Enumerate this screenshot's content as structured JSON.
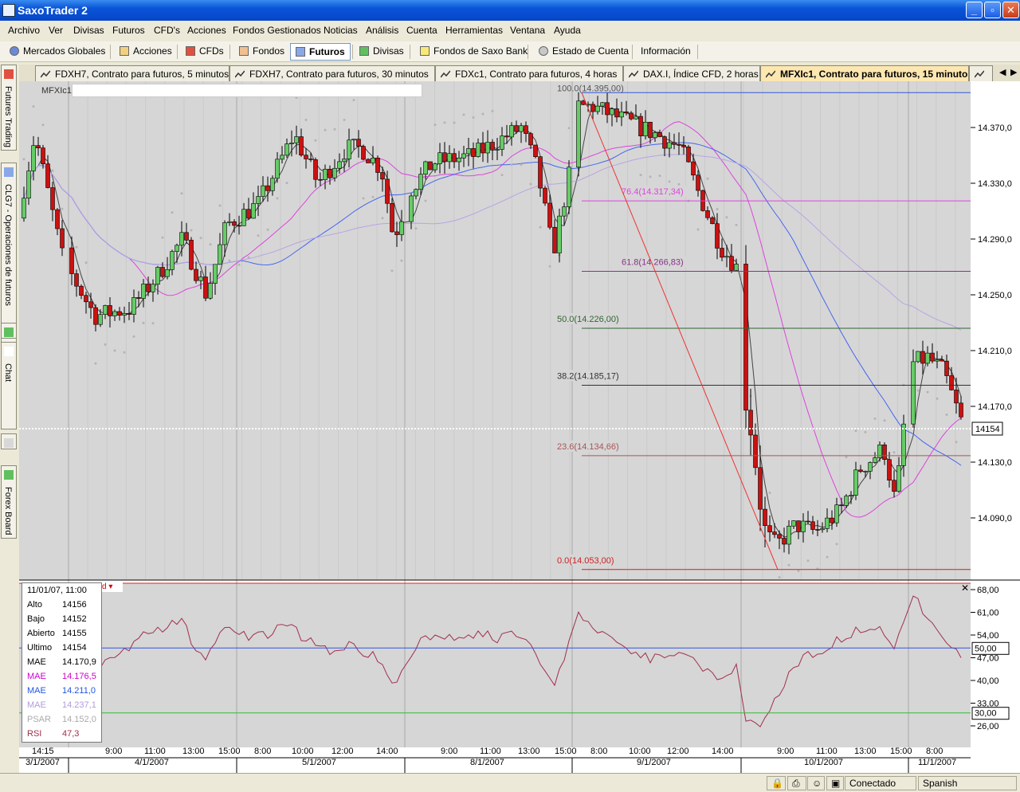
{
  "window": {
    "title": "SaxoTrader 2"
  },
  "menu": [
    "Archivo",
    "Ver",
    "Divisas",
    "Futuros",
    "CFD's",
    "Acciones",
    "Fondos Gestionados",
    "Noticias",
    "Análisis",
    "Cuenta",
    "Herramientas",
    "Ventana",
    "Ayuda"
  ],
  "toolbar": [
    "Mercados Globales",
    "Acciones",
    "CFDs",
    "Fondos",
    "Futuros",
    "Divisas",
    "Fondos de Saxo Bank",
    "Estado de Cuenta",
    "Información"
  ],
  "tabs": [
    "FDXH7, Contrato para futuros, 5 minutos",
    "FDXH7, Contrato para futuros, 30 minutos",
    "FDXc1, Contrato para futuros, 4 horas",
    "DAX.I, Índice CFD, 2 horas",
    "MFXIc1, Contrato para futuros, 15 minutos"
  ],
  "side_tabs": [
    "Futures Trading",
    "CLG7 - Operaciones de futuros",
    "Chat",
    "Forex Board"
  ],
  "chart": {
    "symbol_label": "MFXIc1",
    "price_axis": [
      "14.370,0",
      "14.330,0",
      "14.290,0",
      "14.250,0",
      "14.210,0",
      "14.170,0",
      "14.130,0",
      "14.090,0"
    ],
    "current_price": "14154",
    "fib_levels": [
      "76.4(14.317,34)",
      "61.8(14.266,83)",
      "50.0(14.226,00)",
      "38.2(14.185,17)",
      "23.6(14.134,66)",
      "0.0(14.053,00)"
    ],
    "fib_top_label": "100.0(14.395,00)",
    "rsi_axis": [
      "68,00",
      "61,00",
      "54,00",
      "47,00",
      "40,00",
      "33,00",
      "26,00"
    ],
    "rsi_highlight": [
      "50,00",
      "30,00"
    ],
    "time_labels": [
      "14:15",
      "9:00",
      "11:00",
      "13:00",
      "15:00",
      "8:00",
      "10:00",
      "12:00",
      "14:00",
      "9:00",
      "11:00",
      "13:00",
      "15:00",
      "8:00",
      "10:00",
      "12:00",
      "14:00",
      "9:00",
      "11:00",
      "13:00",
      "15:00",
      "8:00"
    ],
    "date_labels": [
      "3/1/2007",
      "4/1/2007",
      "5/1/2007",
      "8/1/2007",
      "9/1/2007",
      "10/1/2007",
      "11/1/2007"
    ]
  },
  "info": {
    "datetime": "11/01/07, 11:00",
    "rows": [
      {
        "k": "Alto",
        "v": "14156",
        "color": "#000000"
      },
      {
        "k": "Bajo",
        "v": "14152",
        "color": "#000000"
      },
      {
        "k": "Abierto",
        "v": "14155",
        "color": "#000000"
      },
      {
        "k": "Ultimo",
        "v": "14154",
        "color": "#000000"
      },
      {
        "k": "MAE",
        "v": "14.170,9",
        "color": "#000000"
      },
      {
        "k": "MAE",
        "v": "14.176,5",
        "color": "#cc00cc"
      },
      {
        "k": "MAE",
        "v": "14.211,0",
        "color": "#2255dd"
      },
      {
        "k": "MAE",
        "v": "14.237,1",
        "color": "#b09adc"
      },
      {
        "k": "PSAR",
        "v": "14.152,0",
        "color": "#aaaaaa"
      },
      {
        "k": "RSI",
        "v": "47,3",
        "color": "#a0304a"
      }
    ]
  },
  "status": {
    "connection": "Conectado",
    "language": "Spanish"
  }
}
